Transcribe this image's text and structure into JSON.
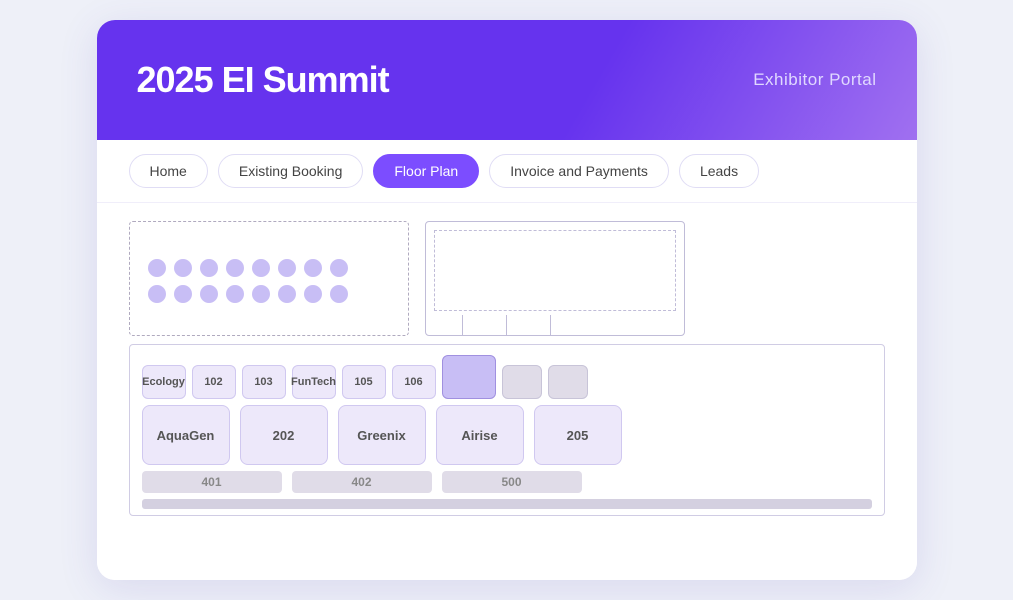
{
  "header": {
    "title": "2025 EI Summit",
    "subtitle": "Exhibitor Portal"
  },
  "nav": {
    "items": [
      {
        "label": "Home",
        "active": false
      },
      {
        "label": "Existing Booking",
        "active": false
      },
      {
        "label": "Floor Plan",
        "active": true
      },
      {
        "label": "Invoice and Payments",
        "active": false
      },
      {
        "label": "Leads",
        "active": false
      }
    ]
  },
  "floorplan": {
    "small_booths_row1": [
      {
        "label": "Ecology",
        "size": "sm"
      },
      {
        "label": "102",
        "size": "sm"
      },
      {
        "label": "103",
        "size": "sm"
      },
      {
        "label": "FunTech",
        "size": "sm"
      },
      {
        "label": "105",
        "size": "sm"
      },
      {
        "label": "106",
        "size": "sm"
      }
    ],
    "large_booths_row": [
      {
        "label": "AquaGen"
      },
      {
        "label": "202"
      },
      {
        "label": "Greenix"
      },
      {
        "label": "Airise"
      },
      {
        "label": "205"
      }
    ],
    "bottom_row": [
      {
        "label": "401"
      },
      {
        "label": "402"
      },
      {
        "label": "500"
      }
    ]
  }
}
